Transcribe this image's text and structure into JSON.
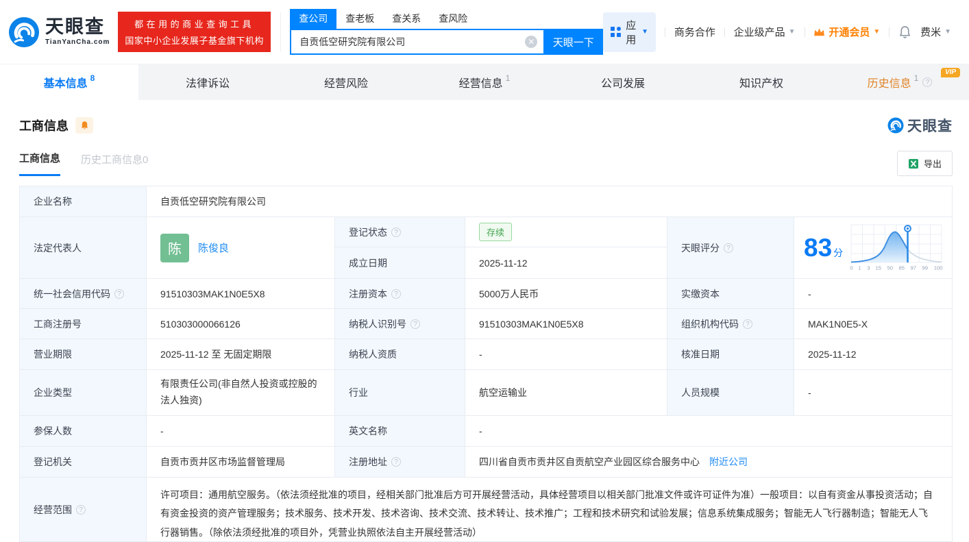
{
  "header": {
    "logo_title": "天眼查",
    "logo_domain": "TianYanCha.com",
    "promo_line1": "都在用的商业查询工具",
    "promo_line2": "国家中小企业发展子基金旗下机构",
    "search_tabs": [
      {
        "label": "查公司"
      },
      {
        "label": "查老板"
      },
      {
        "label": "查关系"
      },
      {
        "label": "查风险"
      }
    ],
    "search_value": "自贡低空研究院有限公司",
    "search_button": "天眼一下",
    "menu_apps": "应用",
    "menu_biz": "商务合作",
    "menu_enterprise": "企业级产品",
    "menu_vip": "开通会员",
    "menu_user": "费米"
  },
  "nav_tabs": [
    {
      "label": "基本信息",
      "count": "8"
    },
    {
      "label": "法律诉讼"
    },
    {
      "label": "经营风险"
    },
    {
      "label": "经营信息",
      "count": "1"
    },
    {
      "label": "公司发展"
    },
    {
      "label": "知识产权"
    },
    {
      "label": "历史信息",
      "count": "1",
      "vip_badge": "VIP"
    }
  ],
  "section": {
    "title": "工商信息",
    "subtab_current": "工商信息",
    "subtab_history": "历史工商信息0",
    "export_label": "导出",
    "watermark": "天眼查"
  },
  "labels": {
    "company_name": "企业名称",
    "legal_rep": "法定代表人",
    "reg_status": "登记状态",
    "establish_date": "成立日期",
    "tyc_score": "天眼评分",
    "credit_code": "统一社会信用代码",
    "reg_capital": "注册资本",
    "paid_capital": "实缴资本",
    "reg_number": "工商注册号",
    "taxpayer_id": "纳税人识别号",
    "org_code": "组织机构代码",
    "business_term": "营业期限",
    "taxpayer_quality": "纳税人资质",
    "approval_date": "核准日期",
    "company_type": "企业类型",
    "industry": "行业",
    "staff_size": "人员规模",
    "insured_count": "参保人数",
    "english_name": "英文名称",
    "reg_authority": "登记机关",
    "reg_address": "注册地址",
    "business_scope": "经营范围"
  },
  "values": {
    "company_name": "自贡低空研究院有限公司",
    "legal_rep_avatar": "陈",
    "legal_rep_name": "陈俊良",
    "reg_status": "存续",
    "establish_date": "2025-11-12",
    "credit_code": "91510303MAK1N0E5X8",
    "reg_capital": "5000万人民币",
    "paid_capital": "-",
    "reg_number": "510303000066126",
    "taxpayer_id": "91510303MAK1N0E5X8",
    "org_code": "MAK1N0E5-X",
    "business_term": "2025-11-12 至 无固定期限",
    "taxpayer_quality": "-",
    "approval_date": "2025-11-12",
    "company_type": "有限责任公司(非自然人投资或控股的法人独资)",
    "industry": "航空运输业",
    "staff_size": "-",
    "insured_count": "-",
    "english_name": "-",
    "reg_authority": "自贡市贡井区市场监督管理局",
    "reg_address": "四川省自贡市贡井区自贡航空产业园区综合服务中心",
    "nearby_link": "附近公司",
    "business_scope": "许可项目：通用航空服务。（依法须经批准的项目，经相关部门批准后方可开展经营活动，具体经营项目以相关部门批准文件或许可证件为准）一般项目：以自有资金从事投资活动；自有资金投资的资产管理服务；技术服务、技术开发、技术咨询、技术交流、技术转让、技术推广；工程和技术研究和试验发展；信息系统集成服务；智能无人飞行器制造；智能无人飞行器销售。（除依法须经批准的项目外，凭营业执照依法自主开展经营活动）"
  },
  "score_chart": {
    "type": "score-distribution-curve",
    "score": "83",
    "unit": "分",
    "marker_value": 85,
    "axis_labels": [
      "0",
      "1",
      "3",
      "15",
      "50",
      "85",
      "97",
      "99",
      "100"
    ]
  },
  "colors": {
    "brand_blue": "#0084ff",
    "active_blue": "#0a7bf5",
    "vip_orange": "#ff8000",
    "status_green": "#46a552",
    "promo_red": "#e7271d",
    "label_bg": "#f2f8fd"
  }
}
